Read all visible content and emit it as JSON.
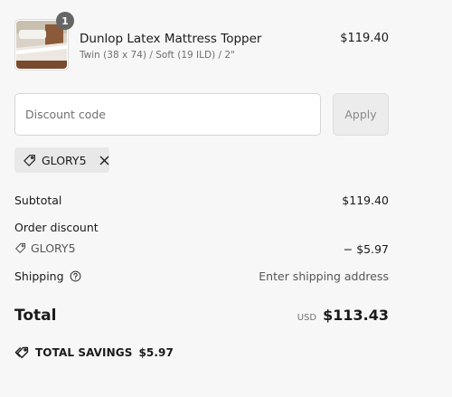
{
  "line_item": {
    "quantity": "1",
    "title": "Dunlop Latex Mattress Topper",
    "variant": "Twin (38 x 74) / Soft (19 ILD) / 2\"",
    "price": "$119.40"
  },
  "discount": {
    "placeholder": "Discount code",
    "value": "",
    "apply_label": "Apply",
    "applied_code": "GLORY5"
  },
  "summary": {
    "subtotal_label": "Subtotal",
    "subtotal_value": "$119.40",
    "order_discount_label": "Order discount",
    "order_discount_code": "GLORY5",
    "order_discount_value": "− $5.97",
    "shipping_label": "Shipping",
    "shipping_value": "Enter shipping address",
    "total_label": "Total",
    "currency": "USD",
    "total_value": "$113.43"
  },
  "savings": {
    "label": "TOTAL SAVINGS",
    "value": "$5.97"
  },
  "icons": {
    "tag": "tag-icon",
    "close": "close-icon",
    "help": "question-circle-icon",
    "savings_tag": "tag-icon"
  },
  "colors": {
    "background": "#f7f7f7",
    "badge": "#666666",
    "chip": "#e8e8e8",
    "apply_disabled": "#ececec"
  }
}
